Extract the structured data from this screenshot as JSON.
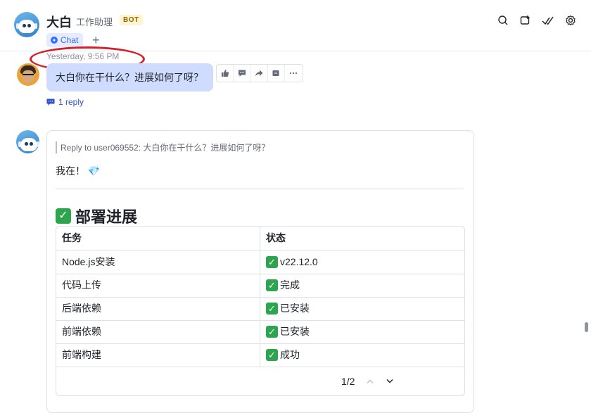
{
  "header": {
    "title": "大白",
    "subtitle": "工作助理",
    "badge": "BOT",
    "tab_label": "Chat",
    "tab_add": "+",
    "icons": [
      "search-icon",
      "add-window-icon",
      "check-icon",
      "settings-icon"
    ]
  },
  "timestamp": "Yesterday, 9:56 PM",
  "message1": {
    "text": "大白你在干什么？进展如何了呀？",
    "reply_label": "1 reply",
    "actions": [
      "thumbs-up-icon",
      "comment-icon",
      "forward-icon",
      "pin-icon",
      "more-icon"
    ]
  },
  "message2": {
    "quote": "Reply to user069552:  大白你在干什么？进展如何了呀？",
    "greeting": "我在！ 💎",
    "section_title": "部署进展",
    "table": {
      "headers": [
        "任务",
        "状态"
      ],
      "rows": [
        {
          "task": "Node.js安装",
          "status": "v22.12.0"
        },
        {
          "task": "代码上传",
          "status": "完成"
        },
        {
          "task": "后端依赖",
          "status": "已安装"
        },
        {
          "task": "前端依赖",
          "status": "已安装"
        },
        {
          "task": "前端构建",
          "status": "成功"
        }
      ]
    },
    "pager": "1/2"
  },
  "colors": {
    "accent": "#3370ff",
    "bubble": "#cfdcff",
    "check": "#2da44e",
    "annotation": "#d4202a"
  }
}
